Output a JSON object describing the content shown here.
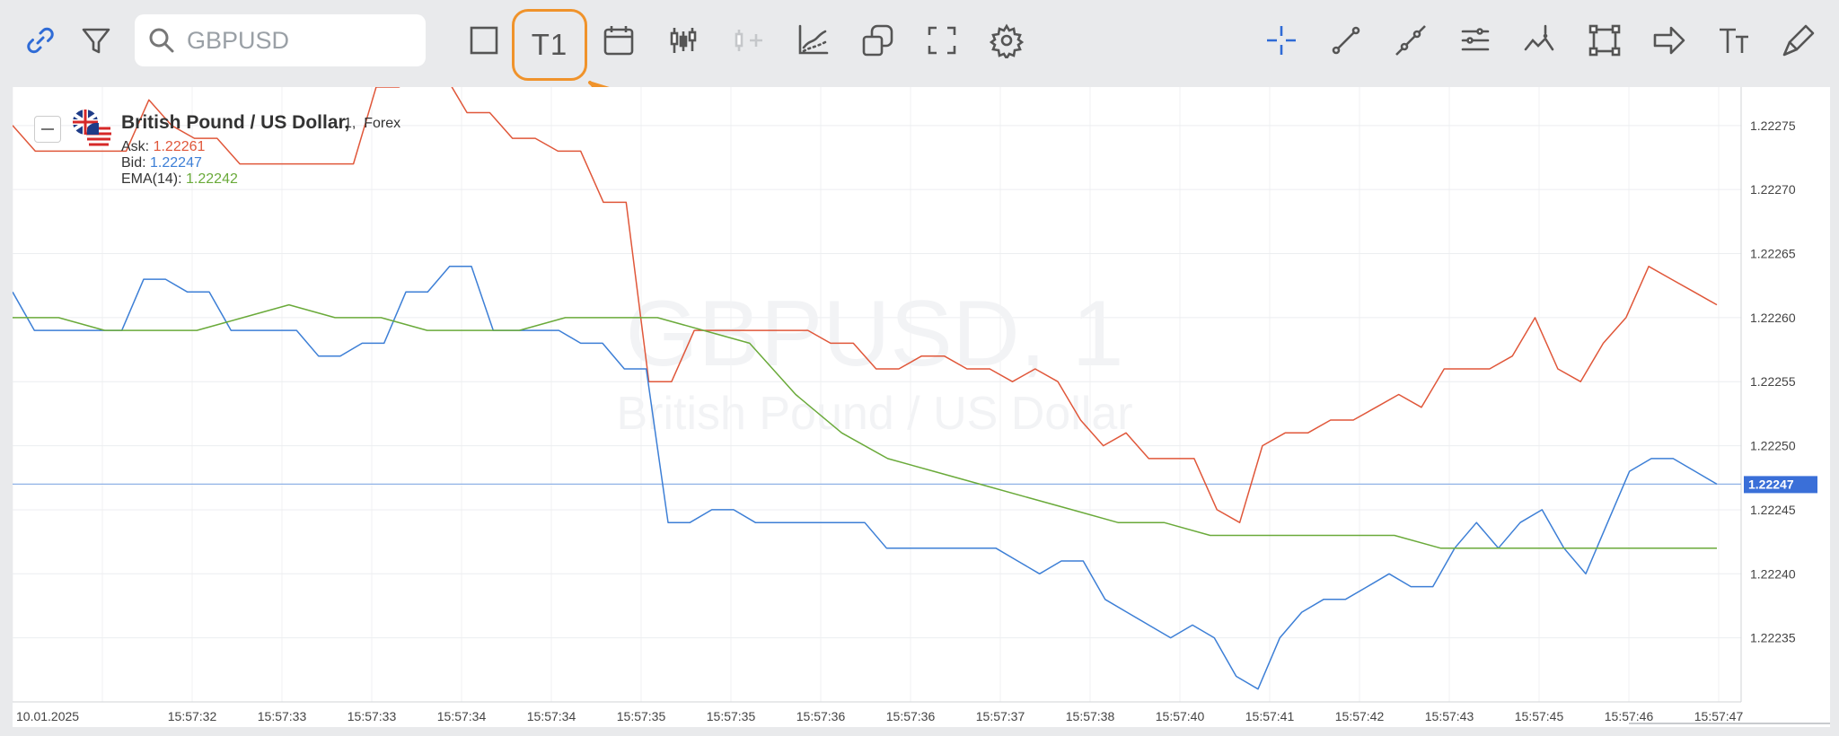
{
  "toolbar": {
    "search_placeholder": "GBPUSD",
    "timeframe_label": "T1",
    "left_icons": [
      "link-icon",
      "filter-icon"
    ],
    "mid_icons": [
      "square-icon",
      "calendar-icon",
      "candlestick-icon",
      "add-indicator-icon",
      "chart-analysis-icon",
      "restore-window-icon",
      "fullscreen-icon",
      "gear-icon"
    ],
    "right_icons": [
      "crosshair-icon",
      "trend-line-icon",
      "ray-line-icon",
      "parallel-lines-icon",
      "annotation-icon",
      "rectangle-tool-icon",
      "arrow-tool-icon",
      "text-tool-icon",
      "brush-icon"
    ]
  },
  "legend": {
    "title": "British Pound / US Dollar,",
    "interval": "1,",
    "market": "Forex",
    "ask_label": "Ask:",
    "ask_value": "1.22261",
    "bid_label": "Bid:",
    "bid_value": "1.22247",
    "ema_label": "EMA(14):",
    "ema_value": "1.22242"
  },
  "watermark": {
    "symbol": "GBPUSD, 1",
    "name": "British Pound / US Dollar"
  },
  "colors": {
    "ask": "#e0573a",
    "bid": "#3d7fd6",
    "ema": "#6aaa3a",
    "accent": "#f0932b",
    "last_price_badge": "#3a6fd8"
  },
  "chart_data": {
    "type": "line",
    "ylim": [
      1.2223,
      1.22278
    ],
    "y_ticks": [
      "1.22275",
      "1.22270",
      "1.22265",
      "1.22260",
      "1.22255",
      "1.22250",
      "1.22245",
      "1.22240",
      "1.22235"
    ],
    "x_ticks": [
      "10.01.2025",
      "15:57:32",
      "15:57:33",
      "15:57:33",
      "15:57:34",
      "15:57:34",
      "15:57:35",
      "15:57:35",
      "15:57:36",
      "15:57:36",
      "15:57:37",
      "15:57:38",
      "15:57:40",
      "15:57:41",
      "15:57:42",
      "15:57:43",
      "15:57:45",
      "15:57:46",
      "15:57:47"
    ],
    "last_price": 1.22247,
    "last_price_label": "1.22247",
    "series": [
      {
        "name": "Ask",
        "values": [
          1.22275,
          1.22273,
          1.22273,
          1.22273,
          1.22273,
          1.22273,
          1.22277,
          1.22275,
          1.22274,
          1.22274,
          1.22272,
          1.22272,
          1.22272,
          1.22272,
          1.22272,
          1.22272,
          1.22278,
          1.22278,
          1.22279,
          1.22279,
          1.22276,
          1.22276,
          1.22274,
          1.22274,
          1.22273,
          1.22273,
          1.22269,
          1.22269,
          1.22255,
          1.22255,
          1.22259,
          1.22259,
          1.22259,
          1.22259,
          1.22259,
          1.22259,
          1.22258,
          1.22258,
          1.22256,
          1.22256,
          1.22257,
          1.22257,
          1.22256,
          1.22256,
          1.22255,
          1.22256,
          1.22255,
          1.22252,
          1.2225,
          1.22251,
          1.22249,
          1.22249,
          1.22249,
          1.22245,
          1.22244,
          1.2225,
          1.22251,
          1.22251,
          1.22252,
          1.22252,
          1.22253,
          1.22254,
          1.22253,
          1.22256,
          1.22256,
          1.22256,
          1.22257,
          1.2226,
          1.22256,
          1.22255,
          1.22258,
          1.2226,
          1.22264,
          1.22263,
          1.22262,
          1.22261
        ]
      },
      {
        "name": "Bid",
        "values": [
          1.22262,
          1.22259,
          1.22259,
          1.22259,
          1.22259,
          1.22259,
          1.22263,
          1.22263,
          1.22262,
          1.22262,
          1.22259,
          1.22259,
          1.22259,
          1.22259,
          1.22257,
          1.22257,
          1.22258,
          1.22258,
          1.22262,
          1.22262,
          1.22264,
          1.22264,
          1.22259,
          1.22259,
          1.22259,
          1.22259,
          1.22258,
          1.22258,
          1.22256,
          1.22256,
          1.22244,
          1.22244,
          1.22245,
          1.22245,
          1.22244,
          1.22244,
          1.22244,
          1.22244,
          1.22244,
          1.22244,
          1.22242,
          1.22242,
          1.22242,
          1.22242,
          1.22242,
          1.22242,
          1.22241,
          1.2224,
          1.22241,
          1.22241,
          1.22238,
          1.22237,
          1.22236,
          1.22235,
          1.22236,
          1.22235,
          1.22232,
          1.22231,
          1.22235,
          1.22237,
          1.22238,
          1.22238,
          1.22239,
          1.2224,
          1.22239,
          1.22239,
          1.22242,
          1.22244,
          1.22242,
          1.22244,
          1.22245,
          1.22242,
          1.2224,
          1.22244,
          1.22248,
          1.22249,
          1.22249,
          1.22248,
          1.22247
        ]
      },
      {
        "name": "EMA(14)",
        "values": [
          1.2226,
          1.2226,
          1.22259,
          1.22259,
          1.22259,
          1.2226,
          1.22261,
          1.2226,
          1.2226,
          1.22259,
          1.22259,
          1.22259,
          1.2226,
          1.2226,
          1.2226,
          1.22259,
          1.22258,
          1.22254,
          1.22251,
          1.22249,
          1.22248,
          1.22247,
          1.22246,
          1.22245,
          1.22244,
          1.22244,
          1.22243,
          1.22243,
          1.22243,
          1.22243,
          1.22243,
          1.22242,
          1.22242,
          1.22242,
          1.22242,
          1.22242,
          1.22242,
          1.22242
        ]
      }
    ]
  }
}
